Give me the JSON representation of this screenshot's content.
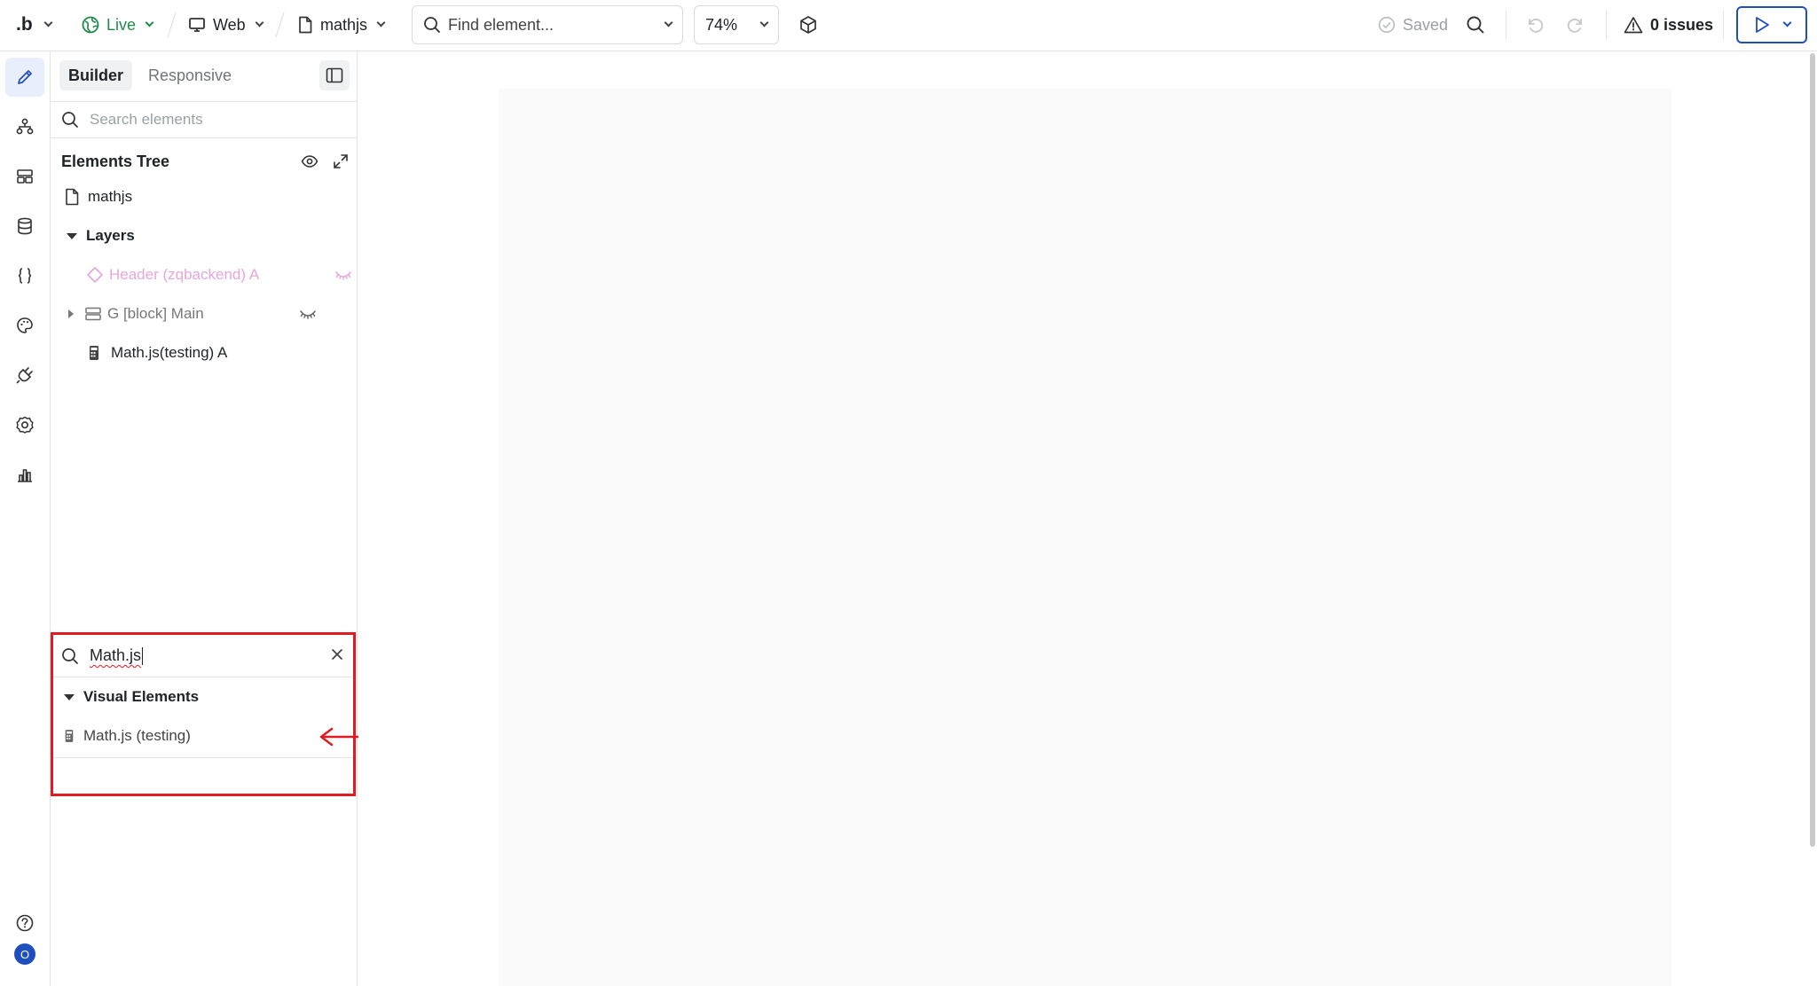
{
  "topbar": {
    "logo": ".b",
    "status": "Live",
    "platform": "Web",
    "page": "mathjs",
    "find_placeholder": "Find element...",
    "zoom": "74%",
    "saved": "Saved",
    "issues": "0 issues"
  },
  "panel": {
    "tabs": [
      {
        "label": "Builder",
        "active": true
      },
      {
        "label": "Responsive",
        "active": false
      }
    ],
    "search_placeholder": "Search elements",
    "tree_title": "Elements Tree",
    "root": "mathjs",
    "layers_label": "Layers",
    "layers": [
      {
        "label": "Header (zqbackend) A",
        "hidden": true
      },
      {
        "label": "G [block] Main",
        "hidden": true
      },
      {
        "label": "Math.js(testing) A",
        "hidden": false
      }
    ]
  },
  "finder": {
    "query": "Math.js",
    "group_label": "Visual Elements",
    "result": "Math.js (testing)"
  },
  "user": {
    "avatar_initial": "O"
  },
  "colors": {
    "accent": "#1f4fbf",
    "live": "#1f8a4c",
    "highlight": "#e01b24",
    "hidden_item": "#e7a6dd"
  }
}
